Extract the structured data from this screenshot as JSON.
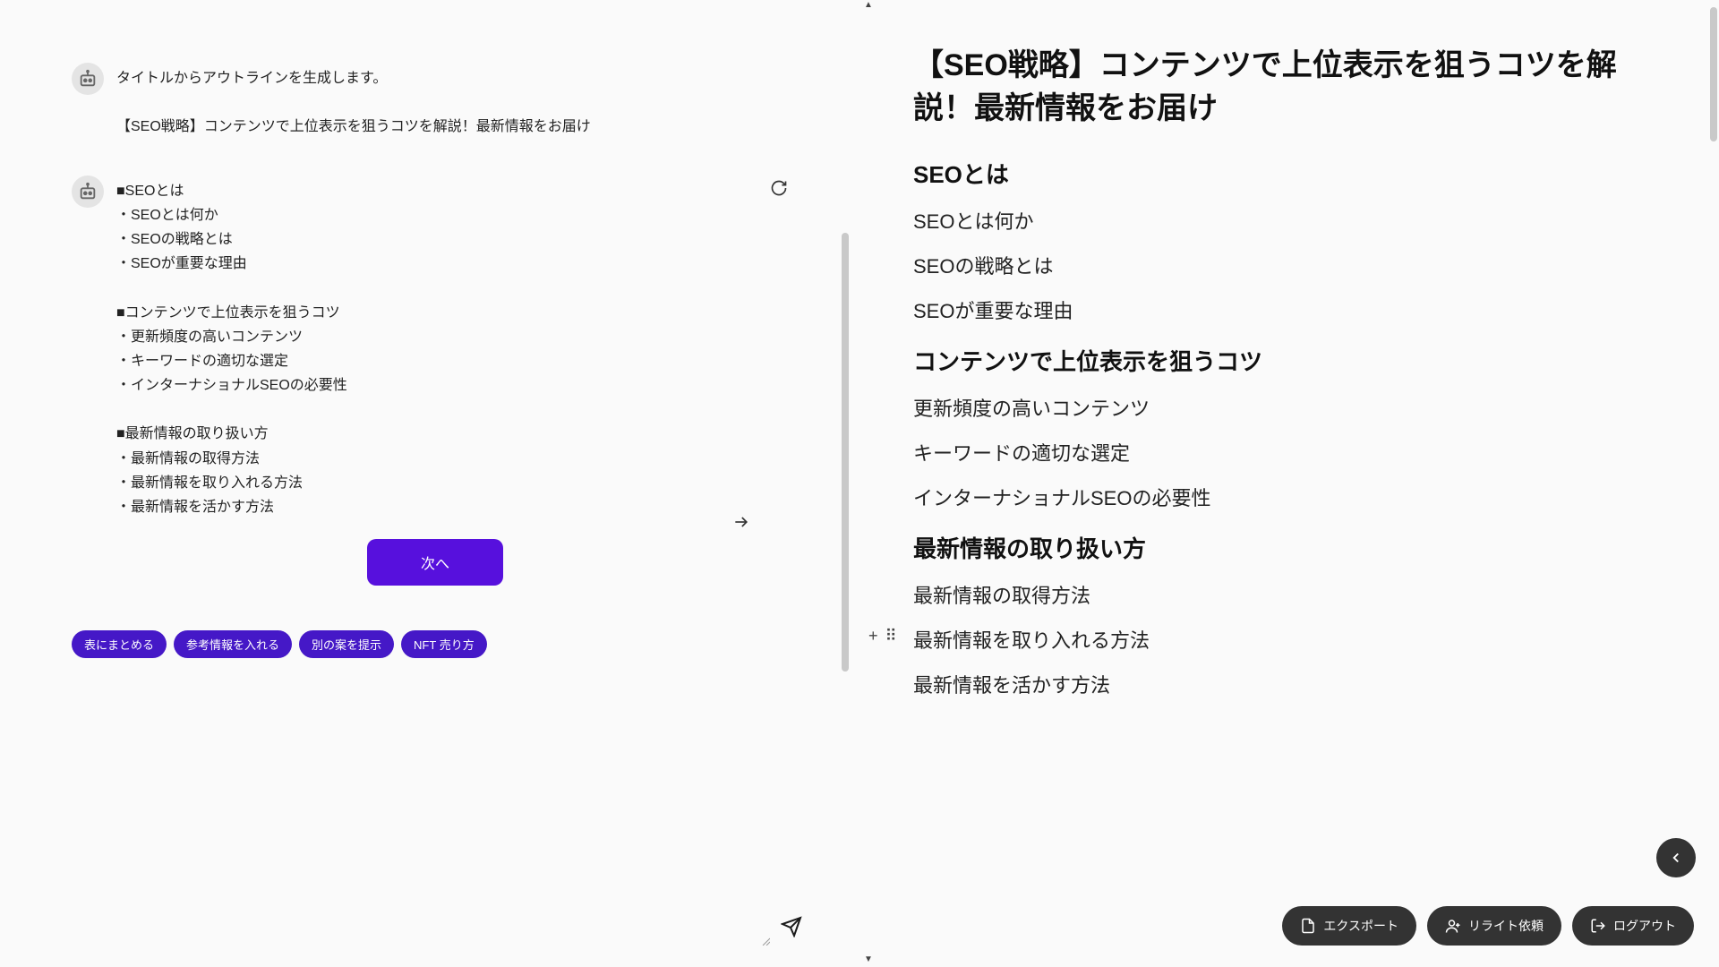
{
  "chat": {
    "messages": [
      {
        "lines": [
          "タイトルからアウトラインを生成します。",
          "",
          "【SEO戦略】コンテンツで上位表示を狙うコツを解説！最新情報をお届け"
        ]
      },
      {
        "lines": [
          "■SEOとは",
          "・SEOとは何か",
          "・SEOの戦略とは",
          "・SEOが重要な理由",
          "",
          "■コンテンツで上位表示を狙うコツ",
          "・更新頻度の高いコンテンツ",
          "・キーワードの適切な選定",
          "・インターナショナルSEOの必要性",
          "",
          "■最新情報の取り扱い方",
          "・最新情報の取得方法",
          "・最新情報を取り入れる方法",
          "・最新情報を活かす方法"
        ]
      }
    ],
    "next_button": "次へ",
    "chips": [
      "表にまとめる",
      "参考情報を入れる",
      "別の案を提示",
      "NFT 売り方"
    ]
  },
  "document": {
    "title": "【SEO戦略】コンテンツで上位表示を狙うコツを解説！最新情報をお届け",
    "outline": [
      {
        "level": 2,
        "text": "SEOとは"
      },
      {
        "level": 3,
        "text": "SEOとは何か"
      },
      {
        "level": 3,
        "text": "SEOの戦略とは"
      },
      {
        "level": 3,
        "text": "SEOが重要な理由"
      },
      {
        "level": 2,
        "text": "コンテンツで上位表示を狙うコツ"
      },
      {
        "level": 3,
        "text": "更新頻度の高いコンテンツ"
      },
      {
        "level": 3,
        "text": "キーワードの適切な選定"
      },
      {
        "level": 3,
        "text": "インターナショナルSEOの必要性"
      },
      {
        "level": 2,
        "text": "最新情報の取り扱い方"
      },
      {
        "level": 3,
        "text": "最新情報の取得方法"
      },
      {
        "level": 3,
        "text": "最新情報を取り入れる方法",
        "hovered": true
      },
      {
        "level": 3,
        "text": "最新情報を活かす方法"
      }
    ]
  },
  "actions": {
    "export": "エクスポート",
    "rewrite": "リライト依頼",
    "logout": "ログアウト"
  }
}
